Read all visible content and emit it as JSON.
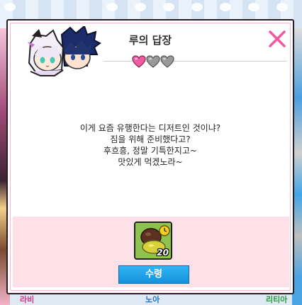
{
  "dialog": {
    "title": "루의 답장",
    "affection": {
      "filled": 1,
      "total": 3
    },
    "message_lines": [
      "이게 요즘 유행한다는 디저트인 것이냐?",
      "짐을 위해 준비했다고?",
      "후흐흥, 정말 기특한지고~",
      "맛있게 먹겠노라~"
    ],
    "reward": {
      "item_icon": "dessert-icon",
      "count": "20"
    },
    "receive_label": "수령"
  },
  "background": {
    "names": [
      "라비",
      "노아",
      "리티아"
    ]
  },
  "colors": {
    "accent_pink": "#f25aa0",
    "button_blue": "#1e9fe8",
    "panel_pink": "#fde0e8"
  }
}
